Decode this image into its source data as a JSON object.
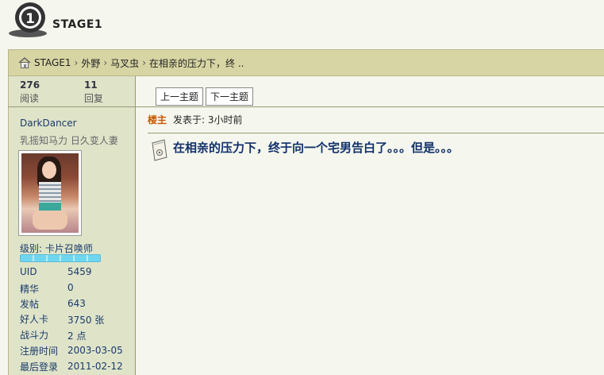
{
  "header": {
    "logo_text": "STAGE1"
  },
  "breadcrumb": {
    "items": [
      "STAGE1",
      "外野",
      "马叉虫",
      "在相亲的压力下，终 .."
    ],
    "separator": "›"
  },
  "stats": {
    "views": {
      "num": "276",
      "label": "阅读"
    },
    "replies": {
      "num": "11",
      "label": "回复"
    }
  },
  "nav": {
    "prev": "上一主题",
    "next": "下一主题"
  },
  "user": {
    "name": "DarkDancer",
    "title": "乳摇知马力 日久变人妻",
    "level": "级别: 卡片召唤师",
    "level_fill": 1.0,
    "info": [
      {
        "label": "UID",
        "value": "5459"
      },
      {
        "label": "精华",
        "value": "0"
      },
      {
        "label": "发帖",
        "value": "643"
      },
      {
        "label": "好人卡",
        "value": "3750 张"
      },
      {
        "label": "战斗力",
        "value": "2 点"
      },
      {
        "label": "注册时间",
        "value": "2003-03-05"
      },
      {
        "label": "最后登录",
        "value": "2011-02-12"
      }
    ]
  },
  "post": {
    "floor": "楼主",
    "time": "发表于: 3小时前",
    "title": "在相亲的压力下，终于向一个宅男告白了。。。但是。。。"
  },
  "colors": {
    "accent": "#cc5500",
    "link": "#1a3a6a",
    "breadcrumb_bg": "#d7d5a3",
    "sidebar_bg": "#dfe4c9"
  }
}
